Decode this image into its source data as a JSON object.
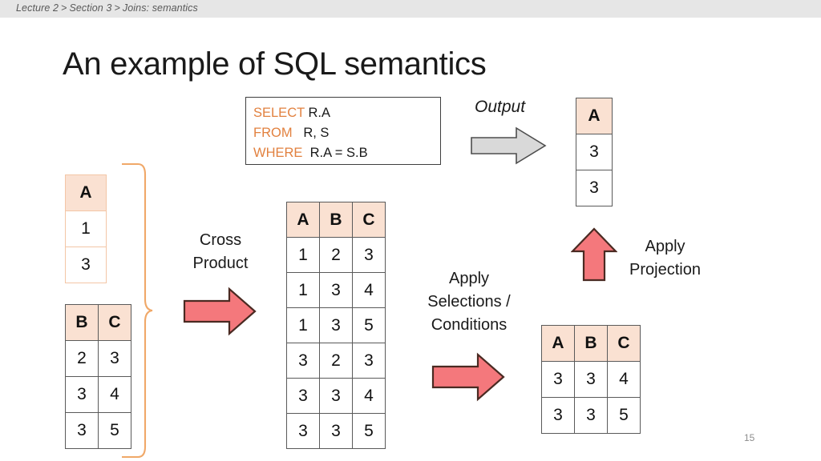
{
  "breadcrumb": {
    "items": [
      "Lecture 2",
      "Section 3",
      "Joins: semantics"
    ],
    "separator": ">"
  },
  "title": "An example of SQL semantics",
  "sql": {
    "line1_keyword": "SELECT",
    "line1_rest": " R.A",
    "line2_keyword": "FROM",
    "line2_rest": "   R, S",
    "line3_keyword": "WHERE",
    "line3_rest": "  R.A = S.B"
  },
  "tables": {
    "r": {
      "name": "relation-r",
      "headers": [
        "A"
      ],
      "rows": [
        [
          "1"
        ],
        [
          "3"
        ]
      ]
    },
    "s": {
      "name": "relation-s",
      "headers": [
        "B",
        "C"
      ],
      "rows": [
        [
          "2",
          "3"
        ],
        [
          "3",
          "4"
        ],
        [
          "3",
          "5"
        ]
      ]
    },
    "cross": {
      "name": "cross-product",
      "headers": [
        "A",
        "B",
        "C"
      ],
      "rows": [
        [
          "1",
          "2",
          "3"
        ],
        [
          "1",
          "3",
          "4"
        ],
        [
          "1",
          "3",
          "5"
        ],
        [
          "3",
          "2",
          "3"
        ],
        [
          "3",
          "3",
          "4"
        ],
        [
          "3",
          "3",
          "5"
        ]
      ]
    },
    "selected": {
      "name": "after-selection",
      "headers": [
        "A",
        "B",
        "C"
      ],
      "rows": [
        [
          "3",
          "3",
          "4"
        ],
        [
          "3",
          "3",
          "5"
        ]
      ]
    },
    "output": {
      "name": "output",
      "headers": [
        "A"
      ],
      "rows": [
        [
          "3"
        ],
        [
          "3"
        ]
      ]
    }
  },
  "labels": {
    "cross_product": [
      "Cross",
      "Product"
    ],
    "apply_selections": [
      "Apply",
      "Selections /",
      "Conditions"
    ],
    "apply_projection": [
      "Apply",
      "Projection"
    ],
    "output": "Output"
  },
  "colors": {
    "keyword_orange": "#e2813f",
    "header_peach": "#fae1d2",
    "arrow_salmon": "#f4787c",
    "arrow_gray": "#d9d9d9",
    "brace_orange": "#f0a868",
    "breadcrumb_bar": "#e6e6e6"
  },
  "page_number": "15"
}
